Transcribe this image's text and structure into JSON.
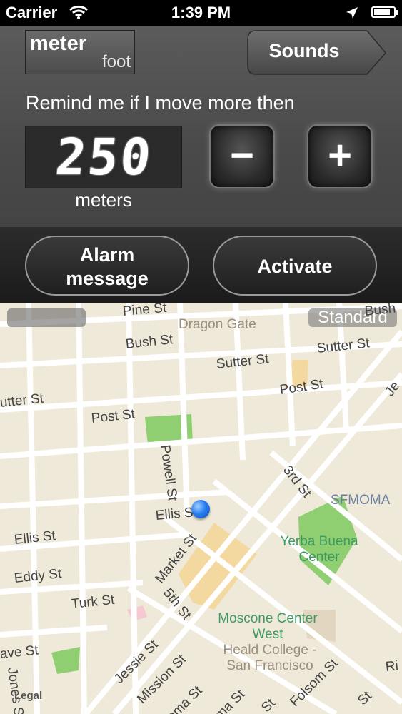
{
  "status_bar": {
    "carrier": "Carrier",
    "time": "1:39 PM",
    "wifi_icon": "wifi-icon",
    "location_icon": "location-arrow-icon",
    "battery_icon": "battery-icon",
    "battery_level": 0.85
  },
  "unit_toggle": {
    "primary": "meter",
    "secondary": "foot"
  },
  "sounds_button": {
    "label": "Sounds"
  },
  "remind_text": "Remind me if I move more then",
  "distance": {
    "value": "250",
    "unit": "meters"
  },
  "stepper": {
    "minus": "−",
    "plus": "+"
  },
  "alarm_button": {
    "line1": "Alarm",
    "line2": "message"
  },
  "activate_button": {
    "label": "Activate"
  },
  "map": {
    "mode_label": "Standard",
    "legal": "Legal",
    "streets": {
      "pine": "Pine St",
      "bush": "Bush St",
      "sutter1": "Sutter St",
      "sutter2": "Sutter St",
      "sutter3": "utter St",
      "post1": "Post St",
      "post2": "Post St",
      "powell": "Powell St",
      "third": "3rd St",
      "ellis1": "Ellis St",
      "ellis2": "Ellis St",
      "market": "Market St",
      "eddy": "Eddy St",
      "turk": "Turk St",
      "fifth": "5th St",
      "jones": "Jones St",
      "jessie": "Jessie St",
      "mission": "Mission St",
      "folsom": "Folsom St",
      "ave": "ave St",
      "toma": "toma St",
      "ma": "ma St",
      "st1": "St",
      "st2": "St",
      "bush2": "Bush",
      "je": "Je",
      "ri": "Ri"
    },
    "pois": {
      "dragon_gate": "Dragon Gate",
      "sfmoma": "SFMOMA",
      "yerba": "Yerba Buena Center",
      "moscone": "Moscone Center West",
      "heald": "Heald College - San Francisco"
    },
    "colors": {
      "land": "#efe9d9",
      "road": "#ffffff",
      "park": "#8fcf72",
      "building": "#f3d9a0",
      "water": "#b7d1e8"
    }
  }
}
